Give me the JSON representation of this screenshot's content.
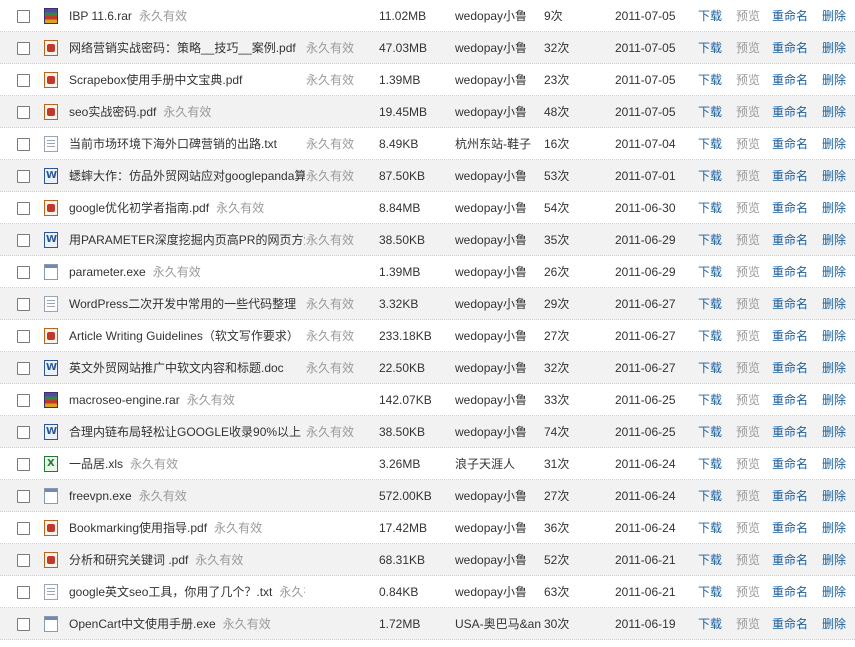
{
  "actions": {
    "download": "下载",
    "preview": "预览",
    "rename": "重命名",
    "delete": "删除"
  },
  "validity_text": "永久有效",
  "watermark": "",
  "files": [
    {
      "name": "IBP 11.6.rar",
      "type": "rar",
      "size": "11.02MB",
      "owner": "wedopay小鲁",
      "count": "9次",
      "date": "2011-07-05",
      "inline_validity": true
    },
    {
      "name": "网络营销实战密码：策略__技巧__案例.pdf",
      "type": "pdf",
      "size": "47.03MB",
      "owner": "wedopay小鲁",
      "count": "32次",
      "date": "2011-07-05",
      "inline_validity": false
    },
    {
      "name": "Scrapebox使用手册中文宝典.pdf",
      "type": "pdf",
      "size": "1.39MB",
      "owner": "wedopay小鲁",
      "count": "23次",
      "date": "2011-07-05",
      "inline_validity": false
    },
    {
      "name": "seo实战密码.pdf",
      "type": "pdf",
      "size": "19.45MB",
      "owner": "wedopay小鲁",
      "count": "48次",
      "date": "2011-07-05",
      "inline_validity": true
    },
    {
      "name": "当前市场环境下海外口碑营销的出路.txt",
      "type": "txt",
      "size": "8.49KB",
      "owner": "杭州东站-鞋子",
      "count": "16次",
      "date": "2011-07-04",
      "inline_validity": false
    },
    {
      "name": "蟋蟀大作：仿品外贸网站应对googlepanda算",
      "type": "doc",
      "size": "87.50KB",
      "owner": "wedopay小鲁",
      "count": "53次",
      "date": "2011-07-01",
      "inline_validity": false
    },
    {
      "name": "google优化初学者指南.pdf",
      "type": "pdf",
      "size": "8.84MB",
      "owner": "wedopay小鲁",
      "count": "54次",
      "date": "2011-06-30",
      "inline_validity": true
    },
    {
      "name": "用PARAMETER深度挖掘内页高PR的网页方法",
      "type": "doc",
      "size": "38.50KB",
      "owner": "wedopay小鲁",
      "count": "35次",
      "date": "2011-06-29",
      "inline_validity": false
    },
    {
      "name": "parameter.exe",
      "type": "exe",
      "size": "1.39MB",
      "owner": "wedopay小鲁",
      "count": "26次",
      "date": "2011-06-29",
      "inline_validity": true
    },
    {
      "name": "WordPress二次开发中常用的一些代码整理",
      "type": "txt",
      "size": "3.32KB",
      "owner": "wedopay小鲁",
      "count": "29次",
      "date": "2011-06-27",
      "inline_validity": false
    },
    {
      "name": "Article Writing Guidelines（软文写作要求）",
      "type": "pdf",
      "size": "233.18KB",
      "owner": "wedopay小鲁",
      "count": "27次",
      "date": "2011-06-27",
      "inline_validity": false
    },
    {
      "name": "英文外贸网站推广中软文内容和标题.doc",
      "type": "doc",
      "size": "22.50KB",
      "owner": "wedopay小鲁",
      "count": "32次",
      "date": "2011-06-27",
      "inline_validity": false
    },
    {
      "name": "macroseo-engine.rar",
      "type": "rar",
      "size": "142.07KB",
      "owner": "wedopay小鲁",
      "count": "33次",
      "date": "2011-06-25",
      "inline_validity": true
    },
    {
      "name": "合理内链布局轻松让GOOGLE收录90%以上",
      "type": "doc",
      "size": "38.50KB",
      "owner": "wedopay小鲁",
      "count": "74次",
      "date": "2011-06-25",
      "inline_validity": false
    },
    {
      "name": "一品居.xls",
      "type": "xls",
      "size": "3.26MB",
      "owner": "浪子天涯人",
      "count": "31次",
      "date": "2011-06-24",
      "inline_validity": true
    },
    {
      "name": "freevpn.exe",
      "type": "exe",
      "size": "572.00KB",
      "owner": "wedopay小鲁",
      "count": "27次",
      "date": "2011-06-24",
      "inline_validity": true
    },
    {
      "name": "Bookmarking使用指导.pdf",
      "type": "pdf",
      "size": "17.42MB",
      "owner": "wedopay小鲁",
      "count": "36次",
      "date": "2011-06-24",
      "inline_validity": true
    },
    {
      "name": "分析和研究关键词 .pdf",
      "type": "pdf",
      "size": "68.31KB",
      "owner": "wedopay小鲁",
      "count": "52次",
      "date": "2011-06-21",
      "inline_validity": true
    },
    {
      "name": "google英文seo工具，你用了几个？.txt",
      "type": "txt",
      "size": "0.84KB",
      "owner": "wedopay小鲁",
      "count": "63次",
      "date": "2011-06-21",
      "inline_validity": true
    },
    {
      "name": "OpenCart中文使用手册.exe",
      "type": "exe",
      "size": "1.72MB",
      "owner": "USA-奥巴马&an",
      "count": "30次",
      "date": "2011-06-19",
      "inline_validity": true
    }
  ]
}
